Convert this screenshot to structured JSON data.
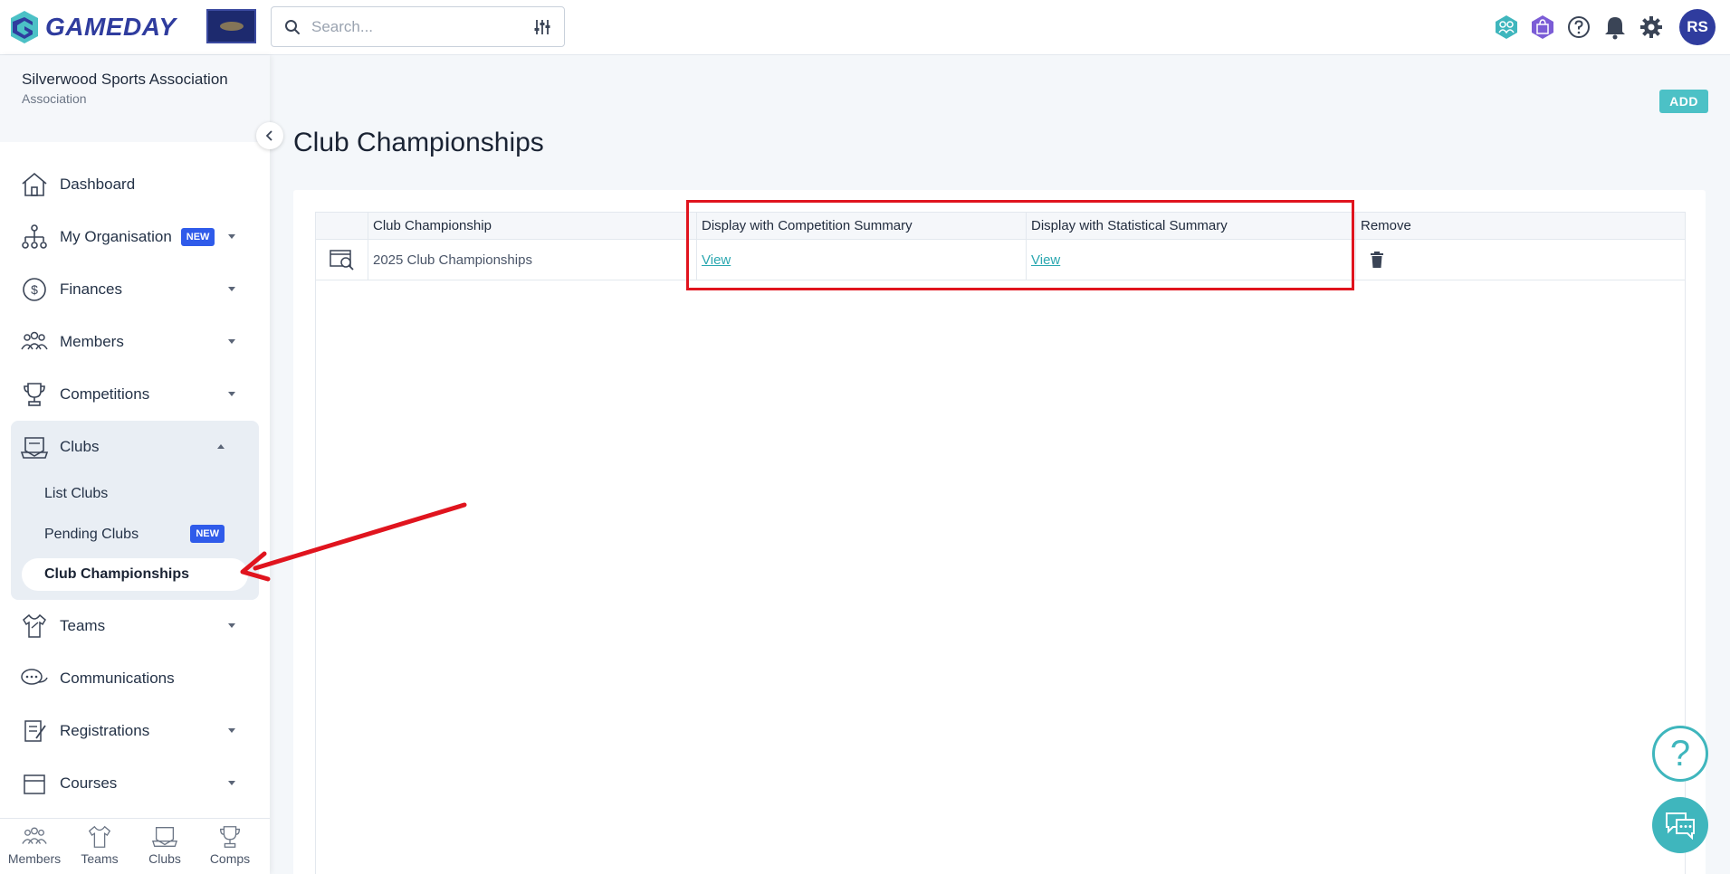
{
  "app": {
    "logo_text": "GAMEDAY"
  },
  "search": {
    "placeholder": "Search..."
  },
  "user": {
    "initials": "RS"
  },
  "org": {
    "name": "Silverwood Sports Association",
    "type": "Association"
  },
  "sidebar": {
    "items": [
      {
        "label": "Dashboard",
        "icon": "home-icon"
      },
      {
        "label": "My Organisation",
        "icon": "org-chart-icon",
        "badge": "NEW"
      },
      {
        "label": "Finances",
        "icon": "dollar-icon"
      },
      {
        "label": "Members",
        "icon": "members-icon"
      },
      {
        "label": "Competitions",
        "icon": "trophy-icon"
      },
      {
        "label": "Clubs",
        "icon": "clubs-icon"
      },
      {
        "label": "Teams",
        "icon": "shirt-icon"
      },
      {
        "label": "Communications",
        "icon": "chat-bubbles-icon"
      },
      {
        "label": "Registrations",
        "icon": "registration-icon"
      },
      {
        "label": "Courses",
        "icon": "calendar-icon"
      }
    ],
    "clubs_sub": [
      {
        "label": "List Clubs"
      },
      {
        "label": "Pending Clubs",
        "badge": "NEW"
      },
      {
        "label": "Club Championships"
      }
    ]
  },
  "bottom_nav": {
    "items": [
      {
        "label": "Members"
      },
      {
        "label": "Teams"
      },
      {
        "label": "Clubs"
      },
      {
        "label": "Comps"
      }
    ]
  },
  "main": {
    "add_label": "ADD",
    "title": "Club Championships",
    "table": {
      "headers": [
        "Club Championship",
        "Display with Competition Summary",
        "Display with Statistical Summary",
        "Remove"
      ],
      "rows": [
        {
          "name": "2025 Club Championships",
          "competition_link": "View",
          "statistical_link": "View"
        }
      ]
    }
  },
  "colors": {
    "brand": "#2f3c9e",
    "accent": "#4cc1c6",
    "badge": "#2f5bea",
    "highlight": "#e0141e"
  },
  "fab": {
    "help_glyph": "?"
  }
}
